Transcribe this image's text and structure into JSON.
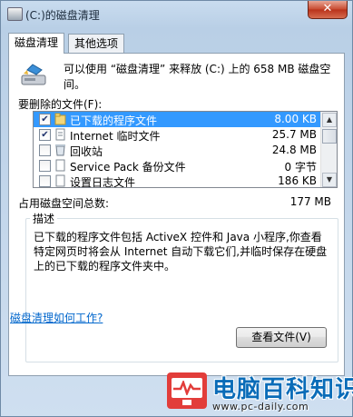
{
  "window": {
    "title": "(C:)的磁盘清理",
    "close_label": "✕"
  },
  "tabs": [
    {
      "label": "磁盘清理"
    },
    {
      "label": "其他选项"
    }
  ],
  "intro_text": "可以使用 “磁盘清理” 来释放  (C:) 上的 658 MB 磁盘空间。",
  "files_label": "要删除的文件(F):",
  "files": [
    {
      "checked": true,
      "name": "已下载的程序文件",
      "size": "8.00 KB",
      "selected": true
    },
    {
      "checked": true,
      "name": "Internet 临时文件",
      "size": "25.7 MB",
      "selected": false
    },
    {
      "checked": false,
      "name": "回收站",
      "size": "24.8 MB",
      "selected": false
    },
    {
      "checked": false,
      "name": "Service Pack 备份文件",
      "size": "0 字节",
      "selected": false
    },
    {
      "checked": false,
      "name": "设置日志文件",
      "size": "186 KB",
      "selected": false
    }
  ],
  "total_label": "占用磁盘空间总数:",
  "total_value": "177 MB",
  "description": {
    "title": "描述",
    "text": "已下载的程序文件包括 ActiveX 控件和 Java 小程序,你查看特定网页时将会从 Internet 自动下载它们,并临时保存在硬盘上的已下载的程序文件夹中。"
  },
  "view_files_button": "查看文件(V)",
  "help_link": "磁盘清理如何工作?",
  "watermark": {
    "title": "电脑百科知识",
    "url": "www.pc-daily.com"
  },
  "colors": {
    "selection": "#3399ff",
    "link": "#0066cc",
    "watermark_red": "#e23d3a",
    "watermark_blue": "#0a6cb8"
  }
}
